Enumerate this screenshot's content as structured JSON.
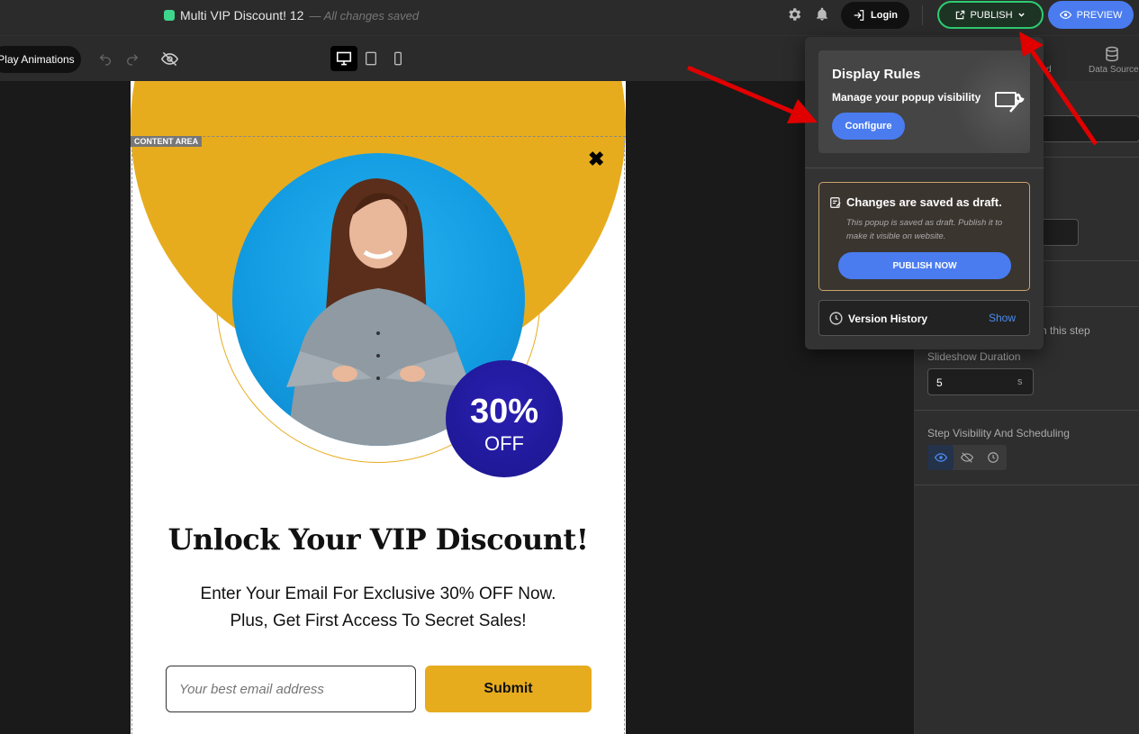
{
  "header": {
    "title": "Multi VIP Discount! 12",
    "save_status": "— All changes saved",
    "login_label": "Login",
    "publish_label": "PUBLISH",
    "preview_label": "PREVIEW"
  },
  "toolbar": {
    "play_animations_label": "Play Animations"
  },
  "popup": {
    "content_area_label": "CONTENT AREA",
    "badge_percent": "30%",
    "badge_off": "OFF",
    "headline": "Unlock Your VIP Discount!",
    "subtext_line1": "Enter Your Email For Exclusive 30% OFF Now.",
    "subtext_line2": "Plus, Get First Access To Secret Sales!",
    "email_placeholder": "Your best email address",
    "submit_label": "Submit",
    "accent_color": "#e7ac1e",
    "badge_color": "#1b178f"
  },
  "publish_dropdown": {
    "display_rules_title": "Display Rules",
    "display_rules_subtitle": "Manage your popup visibility",
    "configure_label": "Configure",
    "draft_title": "Changes are saved as draft.",
    "draft_description": "This popup is saved as draft. Publish it to make it visible on website.",
    "publish_now_label": "PUBLISH NOW",
    "version_history_label": "Version History",
    "version_show_label": "Show"
  },
  "right_panel": {
    "tab_partial_label": "d",
    "data_source_label": "Data Source",
    "step_partial_text": "n this step",
    "slideshow_duration_label": "Slideshow Duration",
    "slideshow_duration_value": "5",
    "slideshow_unit": "s",
    "step_visibility_label": "Step Visibility And Scheduling"
  },
  "colors": {
    "publish_border": "#2ecc71",
    "primary_blue": "#4a7cf0",
    "annotation_arrow": "#e00000"
  }
}
